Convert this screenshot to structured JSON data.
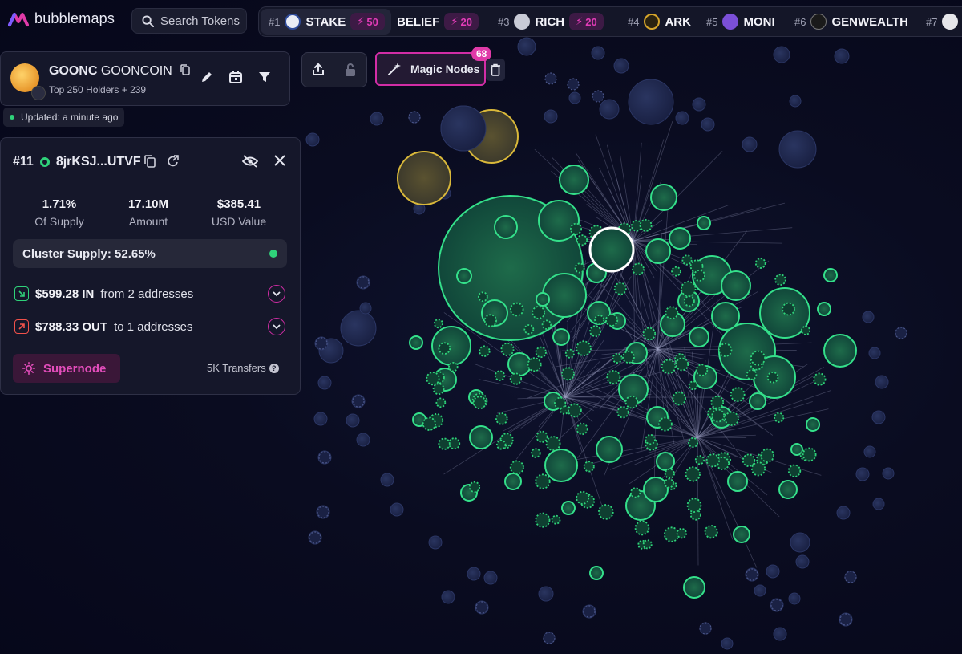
{
  "app": {
    "name": "bubblemaps"
  },
  "search": {
    "placeholder": "Search Tokens"
  },
  "ticker": [
    {
      "rank": "#1",
      "symbol": "STAKE",
      "boost": "50"
    },
    {
      "rank": "",
      "symbol": "BELIEF",
      "boost": "20"
    },
    {
      "rank": "#3",
      "symbol": "RICH",
      "boost": "20"
    },
    {
      "rank": "#4",
      "symbol": "ARK"
    },
    {
      "rank": "#5",
      "symbol": "MONI"
    },
    {
      "rank": "#6",
      "symbol": "GENWEALTH"
    },
    {
      "rank": "#7"
    }
  ],
  "token": {
    "symbol": "GOONC",
    "name": "GOONCOIN",
    "holders": "Top 250 Holders + 239",
    "updated": "Updated: a minute ago"
  },
  "toolbar": {
    "magic_label": "Magic Nodes",
    "magic_count": "68"
  },
  "wallet": {
    "rank": "#11",
    "address": "8jrKSJ...UTVF",
    "stats": [
      {
        "value": "1.71%",
        "label": "Of Supply"
      },
      {
        "value": "17.10M",
        "label": "Amount"
      },
      {
        "value": "$385.41",
        "label": "USD Value"
      }
    ],
    "cluster": "Cluster Supply: 52.65%",
    "in_amount": "$599.28 IN",
    "in_text": "from 2 addresses",
    "out_amount": "$788.33 OUT",
    "out_text": "to 1 addresses",
    "supernode": "Supernode",
    "transfers": "5K Transfers"
  },
  "colors": {
    "accent": "#d22da6",
    "green": "#2fd27a",
    "bubble_blue": "#1e2548",
    "gold": "#c9a227"
  }
}
